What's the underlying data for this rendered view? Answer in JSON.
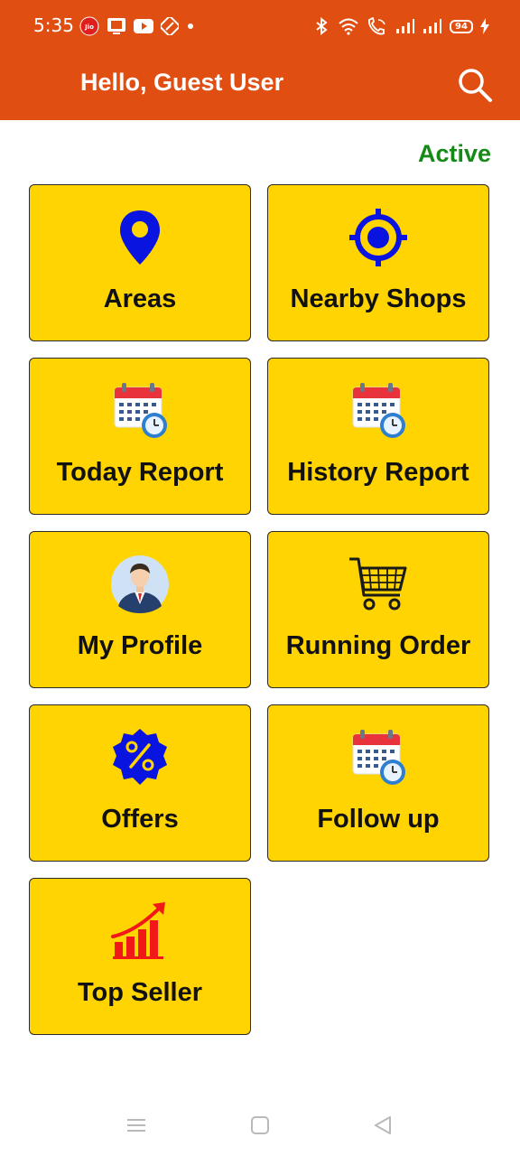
{
  "status_bar": {
    "time": "5:35",
    "carrier_badge": "Jio",
    "battery": "94",
    "left_icons": [
      "jio-icon",
      "tv-icon",
      "youtube-icon",
      "nfc-icon",
      "dot-icon"
    ],
    "right_icons": [
      "bluetooth-icon",
      "wifi-icon",
      "wifi-calling-icon",
      "signal-icon",
      "signal-icon",
      "battery-icon",
      "charging-icon"
    ]
  },
  "app_bar": {
    "title": "Hello, Guest User",
    "search_icon": "search-icon"
  },
  "status_label": "Active",
  "colors": {
    "app_bar": "#e04e12",
    "tile": "#ffd400",
    "active": "#168a16"
  },
  "tiles": [
    {
      "label": "Areas",
      "icon": "map-pin-icon"
    },
    {
      "label": "Nearby Shops",
      "icon": "crosshair-icon"
    },
    {
      "label": "Today Report",
      "icon": "calendar-clock-icon"
    },
    {
      "label": "History Report",
      "icon": "calendar-clock-icon"
    },
    {
      "label": "My Profile",
      "icon": "avatar-icon"
    },
    {
      "label": "Running Order",
      "icon": "shopping-cart-icon"
    },
    {
      "label": "Offers",
      "icon": "percent-badge-icon"
    },
    {
      "label": "Follow up",
      "icon": "calendar-clock-icon"
    },
    {
      "label": "Top Seller",
      "icon": "growth-chart-icon"
    }
  ],
  "nav_bar": [
    "menu-icon",
    "home-icon",
    "back-icon"
  ]
}
